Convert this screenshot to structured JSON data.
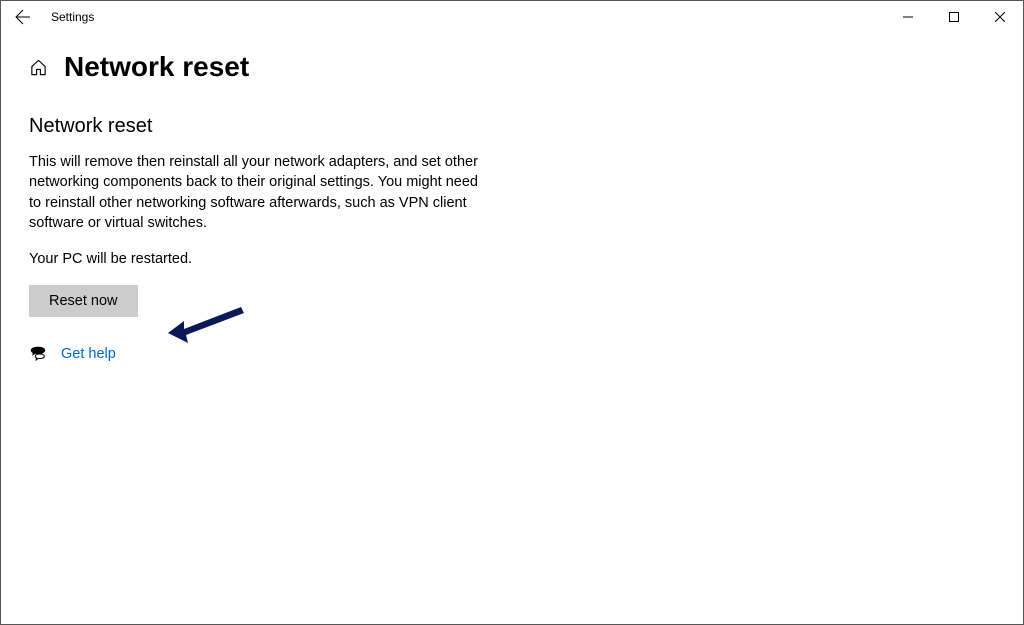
{
  "titlebar": {
    "app_title": "Settings"
  },
  "header": {
    "page_title": "Network reset"
  },
  "main": {
    "section_title": "Network reset",
    "description": "This will remove then reinstall all your network adapters, and set other networking components back to their original settings. You might need to reinstall other networking software afterwards, such as VPN client software or virtual switches.",
    "restart_note": "Your PC will be restarted.",
    "reset_button_label": "Reset now",
    "help_link_label": "Get help"
  },
  "colors": {
    "link": "#0066cc",
    "button_bg": "#cccccc",
    "arrow": "#0b1957"
  }
}
